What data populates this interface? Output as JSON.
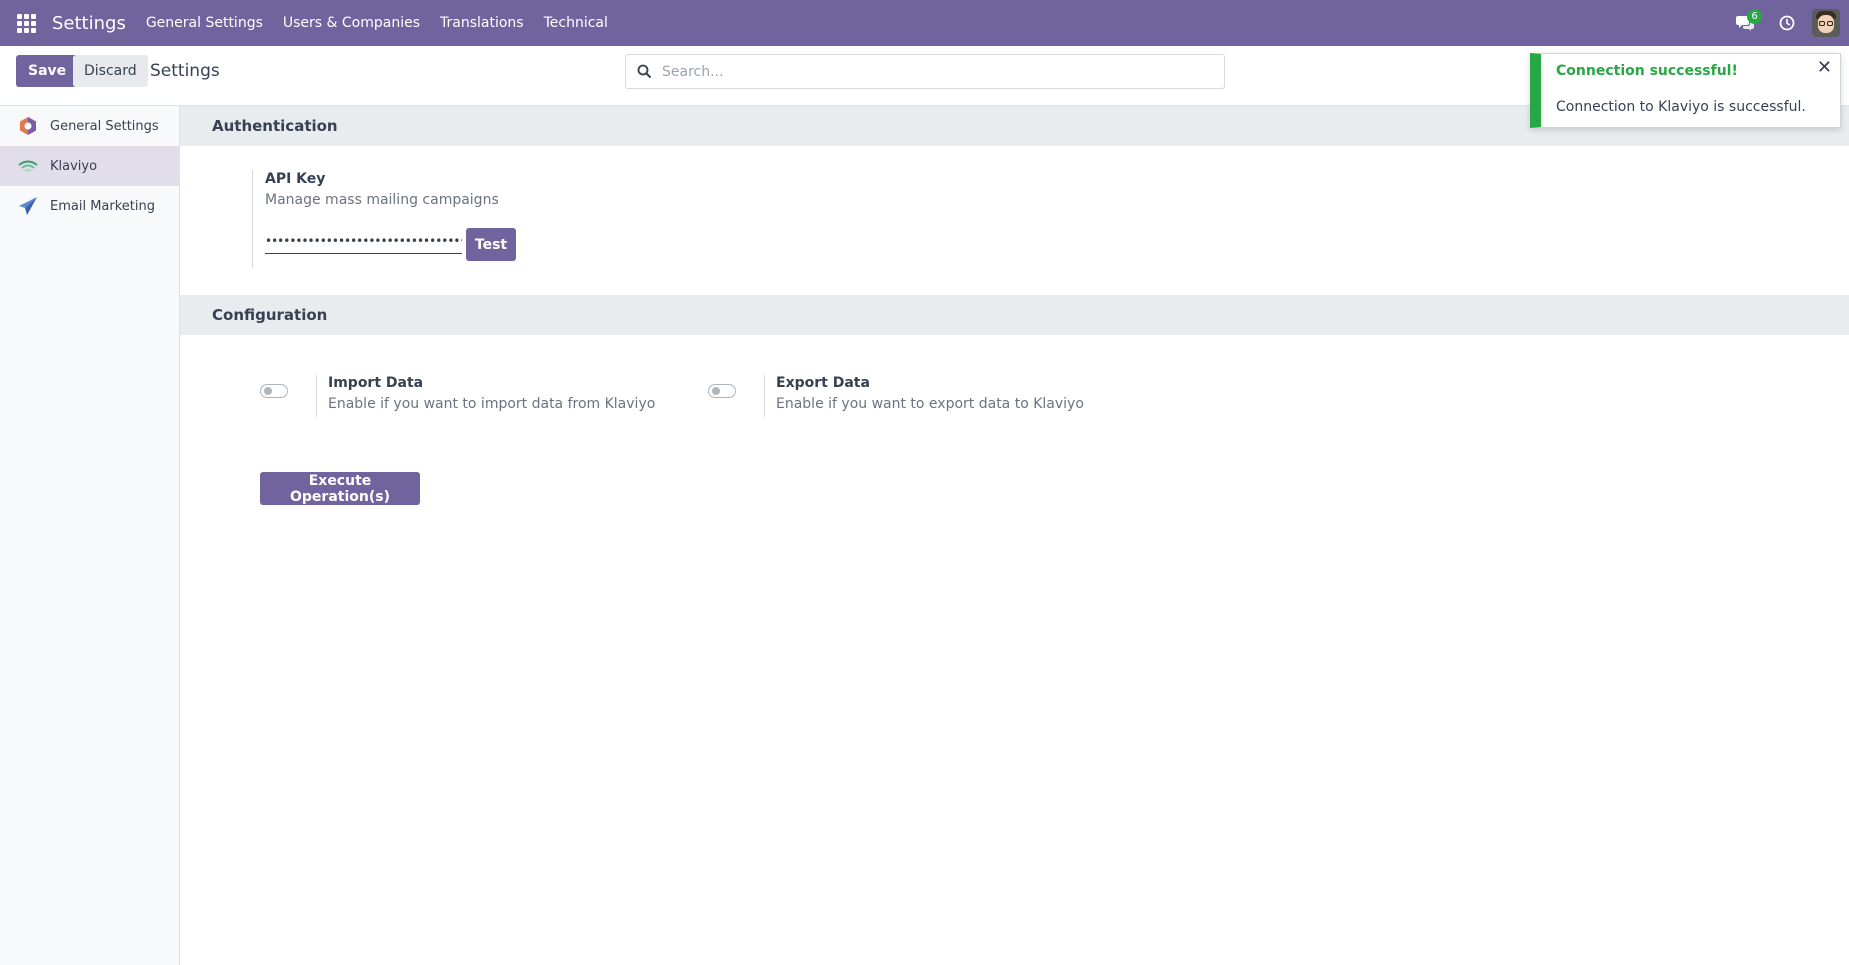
{
  "navbar": {
    "brand": "Settings",
    "menu": [
      "General Settings",
      "Users & Companies",
      "Translations",
      "Technical"
    ],
    "messages_count": "6"
  },
  "control": {
    "save_label": "Save",
    "discard_label": "Discard",
    "title": "Settings",
    "search_placeholder": "Search..."
  },
  "sidebar": {
    "items": [
      {
        "label": "General Settings",
        "icon": "settings-hexagon-icon"
      },
      {
        "label": "Klaviyo",
        "icon": "klaviyo-icon",
        "active": true
      },
      {
        "label": "Email Marketing",
        "icon": "paper-plane-icon"
      }
    ]
  },
  "authentication": {
    "heading": "Authentication",
    "api_key_title": "API Key",
    "api_key_desc": "Manage mass mailing campaigns",
    "api_key_value": "••••••••••••••••••••••••••••••••••••••••",
    "test_label": "Test"
  },
  "configuration": {
    "heading": "Configuration",
    "import_title": "Import Data",
    "import_desc": "Enable if you want to import data from Klaviyo",
    "import_enabled": false,
    "export_title": "Export Data",
    "export_desc": "Enable if you want to export data to Klaviyo",
    "export_enabled": false,
    "execute_label": "Execute Operation(s)"
  },
  "notification": {
    "title": "Connection successful!",
    "body": "Connection to Klaviyo is successful."
  },
  "colors": {
    "primary": "#71639e",
    "success": "#28a745",
    "section_bg": "#e9ecef"
  }
}
